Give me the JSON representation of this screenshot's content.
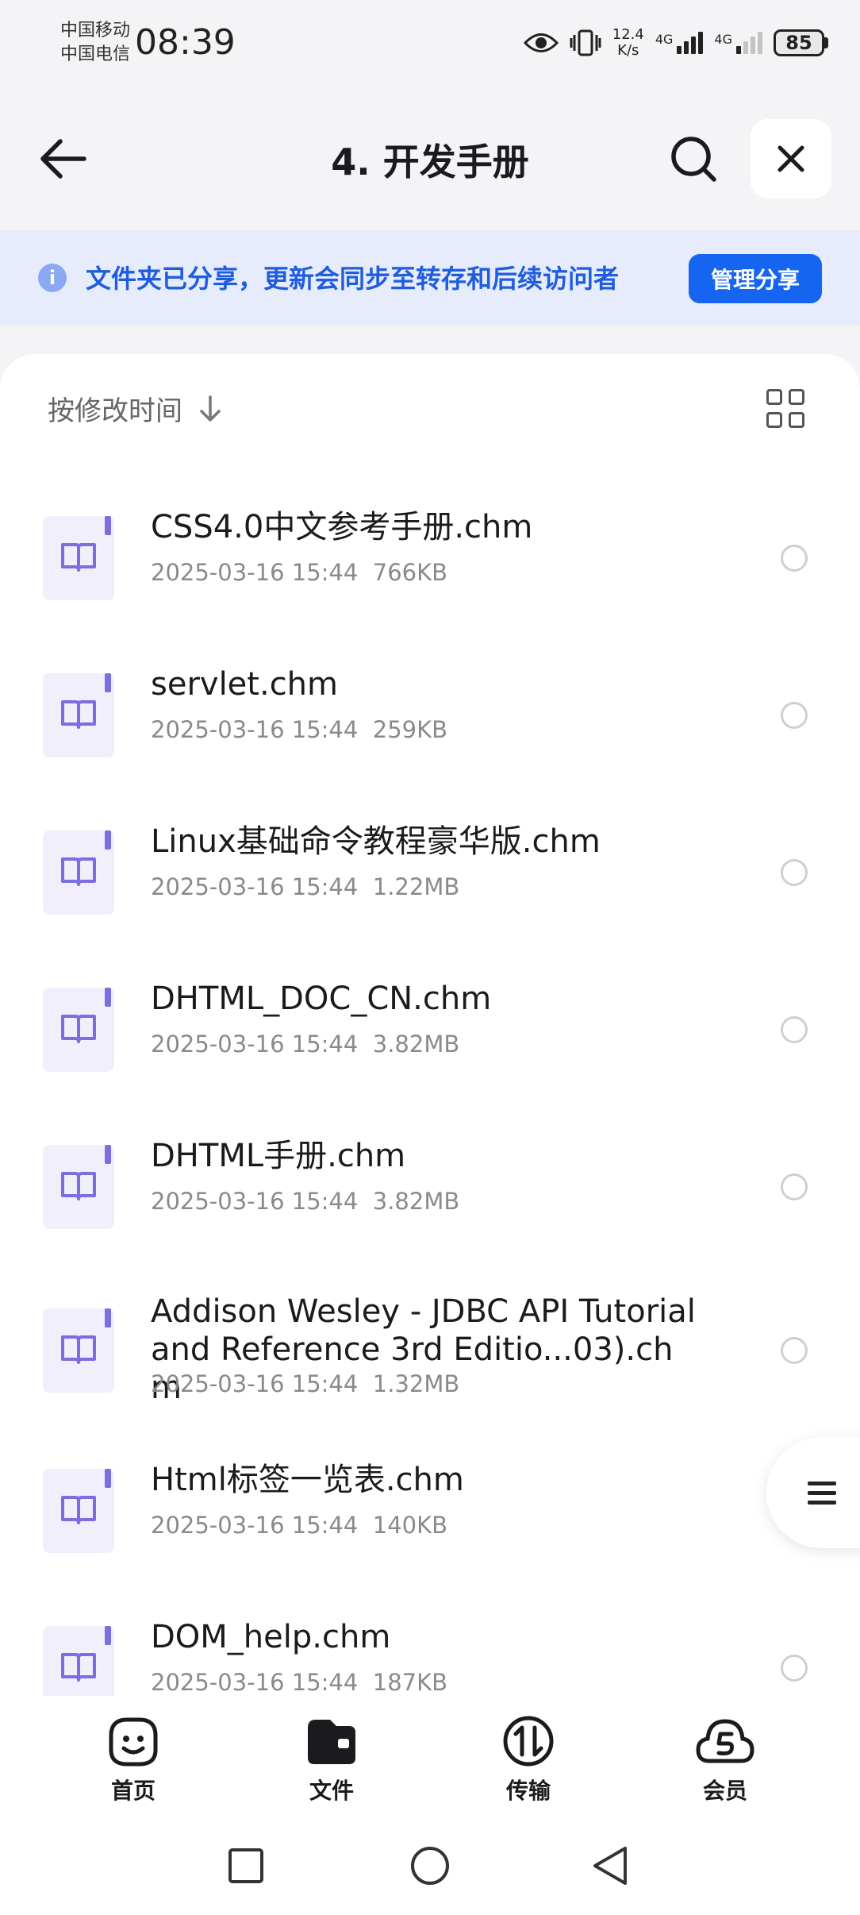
{
  "status_bar": {
    "carrier1": "中国移动",
    "carrier2": "中国电信",
    "time": "08:39",
    "net_speed_value": "12.4",
    "net_speed_unit": "K/s",
    "sig1_label": "4G",
    "sig2_label": "4G",
    "battery": "85"
  },
  "header": {
    "title": "4. 开发手册"
  },
  "banner": {
    "text": "文件夹已分享，更新会同步至转存和后续访问者",
    "button": "管理分享",
    "info_glyph": "i"
  },
  "sort": {
    "label": "按修改时间"
  },
  "files": [
    {
      "name": "CSS4.0中文参考手册.chm",
      "date": "2025-03-16 15:44",
      "size": "766KB"
    },
    {
      "name": "servlet.chm",
      "date": "2025-03-16 15:44",
      "size": "259KB"
    },
    {
      "name": "Linux基础命令教程豪华版.chm",
      "date": "2025-03-16 15:44",
      "size": "1.22MB"
    },
    {
      "name": "DHTML_DOC_CN.chm",
      "date": "2025-03-16 15:44",
      "size": "3.82MB"
    },
    {
      "name": "DHTML手册.chm",
      "date": "2025-03-16 15:44",
      "size": "3.82MB"
    },
    {
      "name": "Addison Wesley - JDBC API Tutorial and Reference 3rd Editio...03).chm",
      "date": "2025-03-16 15:44",
      "size": "1.32MB"
    },
    {
      "name": "Html标签一览表.chm",
      "date": "2025-03-16 15:44",
      "size": "140KB"
    },
    {
      "name": "DOM_help.chm",
      "date": "2025-03-16 15:44",
      "size": "187KB"
    }
  ],
  "bottom_nav": {
    "items": [
      {
        "label": "首页",
        "icon": "home-face-icon"
      },
      {
        "label": "文件",
        "icon": "folder-icon"
      },
      {
        "label": "传输",
        "icon": "transfer-icon"
      },
      {
        "label": "会员",
        "icon": "vip-cloud-icon"
      }
    ],
    "active": "文件"
  },
  "colors": {
    "accent": "#1565f0",
    "banner_bg": "#e6ecfb",
    "banner_text": "#1f5de0",
    "file_icon_bg": "#f0effb",
    "file_icon_accent": "#7b6ee0"
  }
}
